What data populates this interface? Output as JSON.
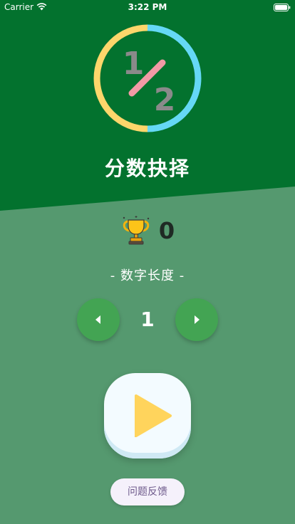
{
  "status_bar": {
    "carrier": "Carrier",
    "time": "3:22 PM",
    "wifi_icon": "wifi-icon",
    "battery_icon": "battery-icon"
  },
  "logo": {
    "numerator": "1",
    "denominator": "2",
    "icon": "fraction-half-logo"
  },
  "app_title": "分数抉择",
  "score": {
    "icon": "trophy-icon",
    "value": "0"
  },
  "length_setting": {
    "label": "- 数字长度 -",
    "value": "1",
    "decrease_icon": "triangle-left-icon",
    "increase_icon": "triangle-right-icon"
  },
  "play": {
    "icon": "play-icon"
  },
  "feedback": {
    "label": "问题反馈"
  },
  "colors": {
    "header_green": "#03722e",
    "background_green": "#55996f",
    "stepper_green": "#43a453",
    "play_yellow": "#ffd45c",
    "ring_yellow": "#fdd66b",
    "ring_blue": "#65d8f6"
  }
}
